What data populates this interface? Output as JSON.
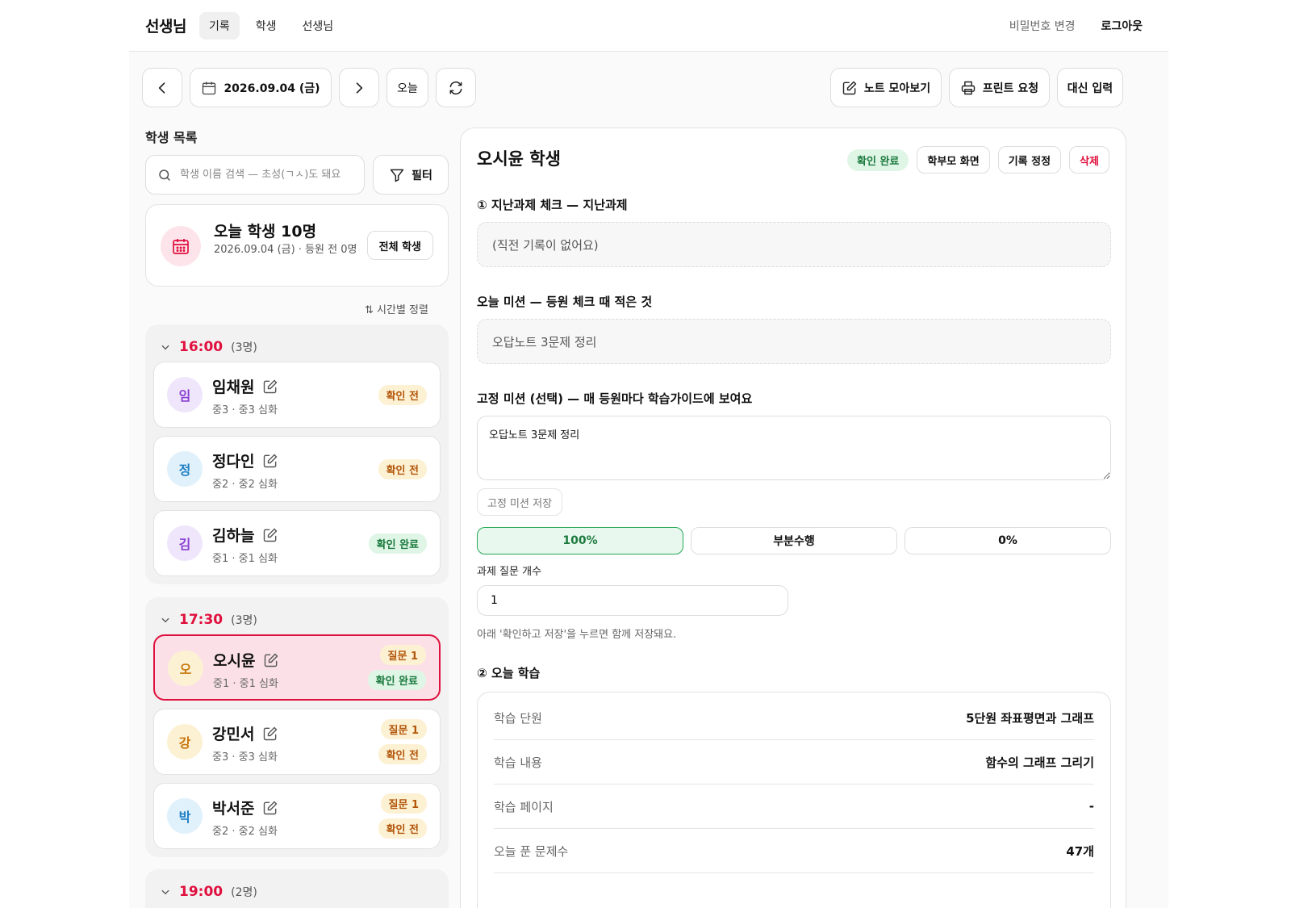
{
  "nav": {
    "brand": "선생님",
    "tabs": [
      {
        "label": "기록"
      },
      {
        "label": "학생"
      },
      {
        "label": "선생님"
      }
    ],
    "change_password": "비밀번호 변경",
    "logout": "로그아웃"
  },
  "toolbar": {
    "date": "2026.09.04 (금)",
    "today": "오늘",
    "note_collect": "노트 모아보기",
    "print_request": "프린트 요청",
    "proxy_input": "대신 입력"
  },
  "sidebar": {
    "title": "학생 목록",
    "search_placeholder": "학생 이름 검색 — 초성(ㄱㅅ)도 돼요",
    "filter": "필터",
    "today_card": {
      "title": "오늘 학생 10명",
      "subtitle": "2026.09.04 (금) · 등원 전 0명",
      "all_button": "전체 학생"
    },
    "sort": "시간별 정렬",
    "groups": [
      {
        "time": "16:00",
        "count": "(3명)",
        "students": [
          {
            "initial": "임",
            "name": "임채원",
            "meta": "중3 · 중3 심화",
            "badges": [
              {
                "text": "확인 전",
                "kind": "wait"
              }
            ]
          },
          {
            "initial": "정",
            "name": "정다인",
            "meta": "중2 · 중2 심화",
            "badges": [
              {
                "text": "확인 전",
                "kind": "wait"
              }
            ]
          },
          {
            "initial": "김",
            "name": "김하늘",
            "meta": "중1 · 중1 심화",
            "badges": [
              {
                "text": "확인 완료",
                "kind": "ok"
              }
            ]
          }
        ]
      },
      {
        "time": "17:30",
        "count": "(3명)",
        "students": [
          {
            "initial": "오",
            "name": "오시윤",
            "meta": "중1 · 중1 심화",
            "badges": [
              {
                "text": "질문 1",
                "kind": "q"
              },
              {
                "text": "확인 완료",
                "kind": "ok"
              }
            ]
          },
          {
            "initial": "강",
            "name": "강민서",
            "meta": "중3 · 중3 심화",
            "badges": [
              {
                "text": "질문 1",
                "kind": "q"
              },
              {
                "text": "확인 전",
                "kind": "wait"
              }
            ]
          },
          {
            "initial": "박",
            "name": "박서준",
            "meta": "중2 · 중2 심화",
            "badges": [
              {
                "text": "질문 1",
                "kind": "q"
              },
              {
                "text": "확인 전",
                "kind": "wait"
              }
            ]
          }
        ]
      },
      {
        "time": "19:00",
        "count": "(2명)",
        "students": []
      }
    ]
  },
  "detail": {
    "title": "오시윤 학생",
    "status": "확인 완료",
    "parent_view": "학부모 화면",
    "edit_record": "기록 정정",
    "delete": "삭제",
    "sec1_title": "① 지난과제 체크 — 지난과제",
    "sec1_empty": "(직전 기록이 없어요)",
    "mission_title": "오늘 미션 — 등원 체크 때 적은 것",
    "mission_value": "오답노트 3문제 정리",
    "fixed_title": "고정 미션 (선택) — 매 등원마다 학습가이드에 보여요",
    "fixed_value": "오답노트 3문제 정리",
    "fixed_save": "고정 미션 저장",
    "completion": [
      "100%",
      "부분수행",
      "0%"
    ],
    "completion_selected": "100%",
    "question_label": "과제 질문 개수",
    "question_value": "1",
    "hint": "아래 '확인하고 저장'을 누르면 함께 저장돼요.",
    "sec2_title": "② 오늘 학습",
    "study": [
      {
        "key": "학습 단원",
        "value": "5단원 좌표평면과 그래프"
      },
      {
        "key": "학습 내용",
        "value": "함수의 그래프 그리기"
      },
      {
        "key": "학습 페이지",
        "value": "-"
      },
      {
        "key": "오늘 푼 문제수",
        "value": "47개"
      }
    ]
  },
  "colors": {
    "accent": "#e0103e",
    "ok_green": "#1b7a3e",
    "wait_orange": "#b2560a"
  }
}
